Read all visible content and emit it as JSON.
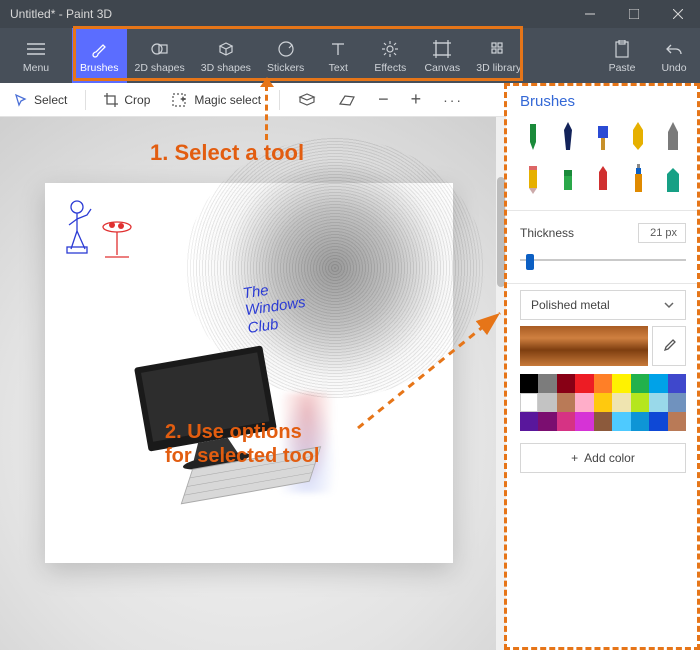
{
  "window": {
    "title": "Untitled* - Paint 3D"
  },
  "toolbar": {
    "menu": "Menu",
    "items": [
      {
        "id": "brushes",
        "label": "Brushes"
      },
      {
        "id": "2dshapes",
        "label": "2D shapes"
      },
      {
        "id": "3dshapes",
        "label": "3D shapes"
      },
      {
        "id": "stickers",
        "label": "Stickers"
      },
      {
        "id": "text",
        "label": "Text"
      },
      {
        "id": "effects",
        "label": "Effects"
      },
      {
        "id": "canvas",
        "label": "Canvas"
      },
      {
        "id": "3dlib",
        "label": "3D library"
      }
    ],
    "paste": "Paste",
    "undo": "Undo"
  },
  "secondary": {
    "select": "Select",
    "crop": "Crop",
    "magic": "Magic select"
  },
  "side": {
    "title": "Brushes",
    "thickness_label": "Thickness",
    "thickness_value": "21 px",
    "material": "Polished metal",
    "addcolor": "Add color",
    "palette": [
      "#000000",
      "#7c7c7c",
      "#880015",
      "#ed1c24",
      "#ff7f27",
      "#fff200",
      "#22b14c",
      "#00a2e8",
      "#3f48cc",
      "#ffffff",
      "#c3c3c3",
      "#b97a57",
      "#ffaec9",
      "#ffc90e",
      "#efe4b0",
      "#b5e61d",
      "#99d9ea",
      "#7092be",
      "#59179c",
      "#7b0e70",
      "#d63384",
      "#d633d6",
      "#8c5a3c",
      "#4ecaff",
      "#0e95d6",
      "#0e48d6",
      "#b97a57"
    ]
  },
  "canvas_art": {
    "line1": "The",
    "line2": "Windows",
    "line3": "Club"
  },
  "annotations": {
    "step1": "1. Select a tool",
    "step2a": "2. Use options",
    "step2b": "for selected tool"
  }
}
